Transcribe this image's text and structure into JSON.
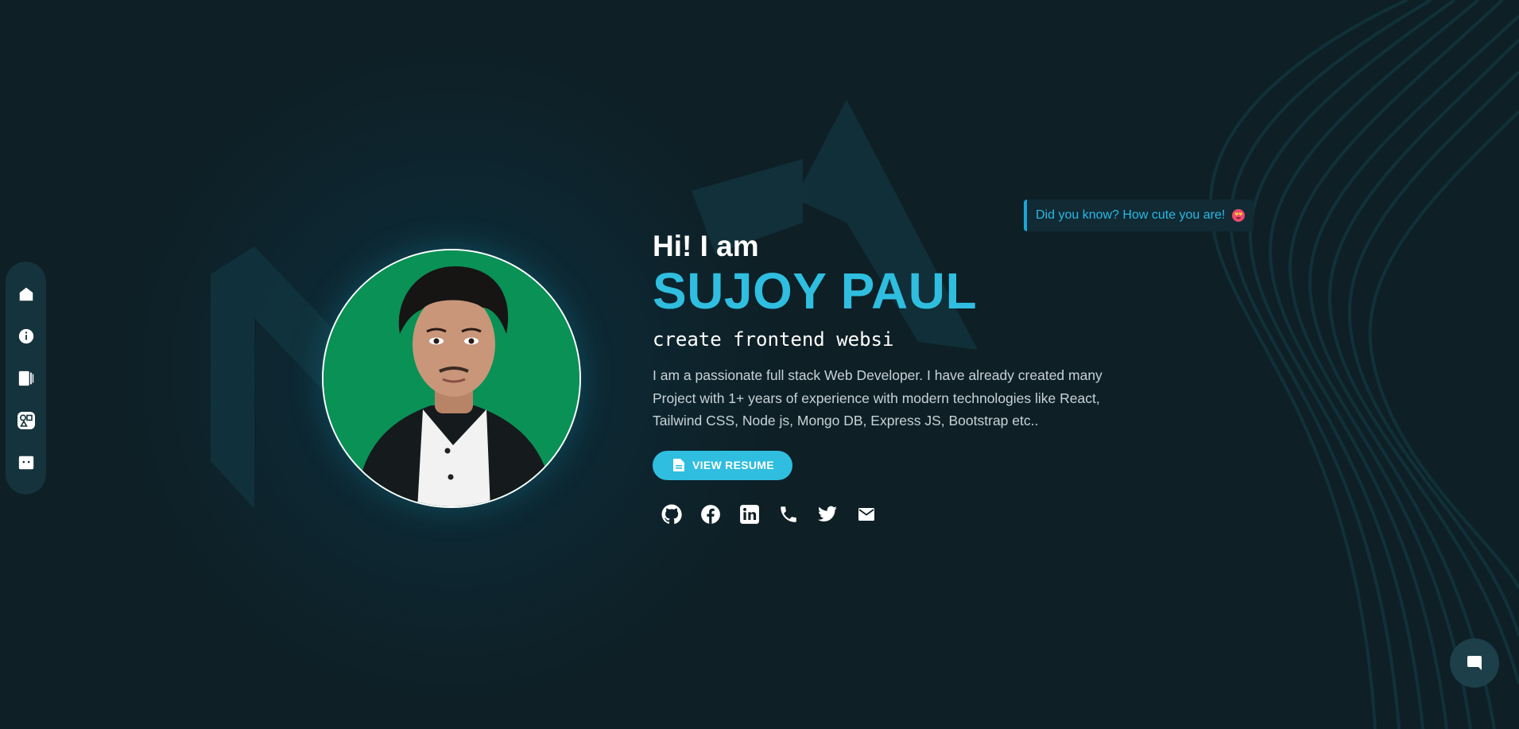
{
  "sidenav": {
    "items": [
      {
        "icon": "home-icon"
      },
      {
        "icon": "info-icon"
      },
      {
        "icon": "projects-icon"
      },
      {
        "icon": "skills-icon"
      },
      {
        "icon": "contact-icon"
      }
    ]
  },
  "hero": {
    "greeting": "Hi! I am",
    "name": "SUJOY PAUL",
    "typed_text": "create frontend websi",
    "bio": "I am a passionate full stack Web Developer. I have already created many Project with 1+ years of experience with modern technologies like React, Tailwind CSS, Node js, Mongo DB, Express JS, Bootstrap etc..",
    "resume_label": "VIEW RESUME"
  },
  "socials": [
    "github-icon",
    "facebook-icon",
    "linkedin-icon",
    "phone-icon",
    "twitter-icon",
    "email-icon"
  ],
  "funfact": {
    "text": "Did you know? How cute you are!",
    "emoji_icon": "heart-eyes-emoji-icon"
  },
  "colors": {
    "background": "#0e1f26",
    "accent": "#2fbedf",
    "nav_bg": "#14333d",
    "photo_bg": "#0a9156"
  }
}
